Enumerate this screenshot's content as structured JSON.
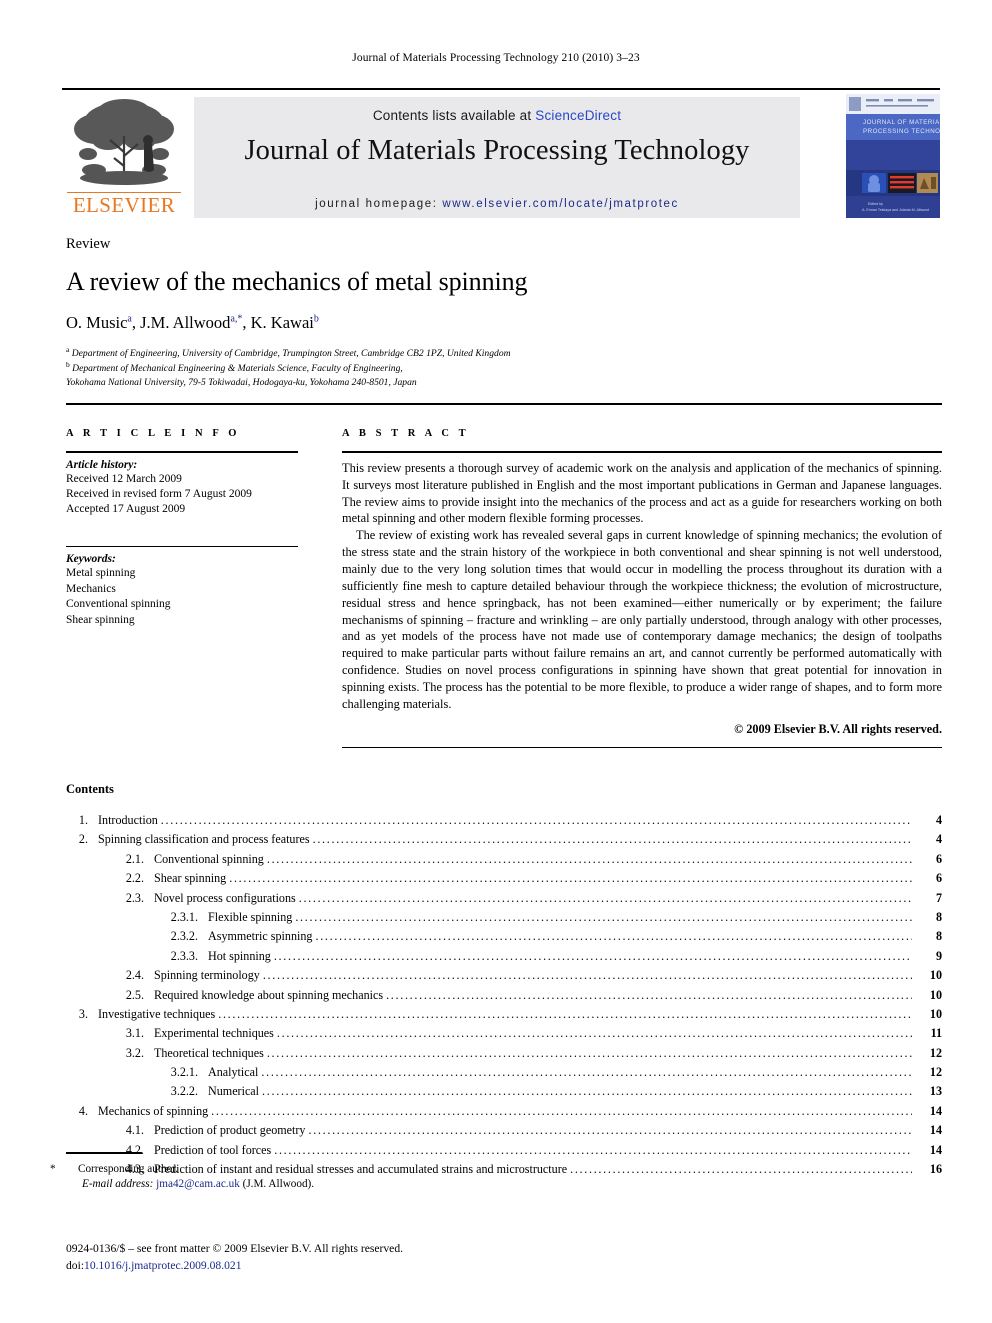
{
  "running_head": "Journal of Materials Processing Technology 210 (2010) 3–23",
  "masthead": {
    "contents_prefix": "Contents lists available at ",
    "sciencedirect": "ScienceDirect",
    "journal_title": "Journal of Materials Processing Technology",
    "homepage_prefix": "journal homepage:",
    "homepage_url": "www.elsevier.com/locate/jmatprotec",
    "publisher": "ELSEVIER",
    "cover": {
      "line1": "JOURNAL OF MATERIALS",
      "line2": "PROCESSING TECHNOLOGY",
      "edited_by": "Edited by",
      "editors": "A. Erman Tekkaya and Jolanta M. Allwood"
    },
    "link_color": "#2a46c8",
    "url_color": "#1b2a8a",
    "elsevier_orange": "#E87722",
    "banner_bg": "#e9e9eb"
  },
  "title_block": {
    "doctype": "Review",
    "title": "A review of the mechanics of metal spinning",
    "authors": [
      {
        "name": "O. Music",
        "sup": "a"
      },
      {
        "name": "J.M. Allwood",
        "sup": "a,*"
      },
      {
        "name": "K. Kawai",
        "sup": "b"
      }
    ],
    "affiliations": [
      {
        "marker": "a",
        "text": "Department of Engineering, University of Cambridge, Trumpington Street, Cambridge CB2 1PZ, United Kingdom"
      },
      {
        "marker": "b",
        "text": "Department of Mechanical Engineering & Materials Science, Faculty of Engineering,"
      },
      {
        "marker": "",
        "text": "Yokohama National University, 79-5 Tokiwadai, Hodogaya-ku, Yokohama 240-8501, Japan"
      }
    ]
  },
  "article_info": {
    "heading": "A R T I C L E    I N F O",
    "history_label": "Article history:",
    "history": [
      "Received 12 March 2009",
      "Received in revised form 7 August 2009",
      "Accepted 17 August 2009"
    ],
    "keywords_label": "Keywords:",
    "keywords": [
      "Metal spinning",
      "Mechanics",
      "Conventional spinning",
      "Shear spinning"
    ]
  },
  "abstract": {
    "heading": "A B S T R A C T",
    "paragraphs": [
      "This review presents a thorough survey of academic work on the analysis and application of the mechanics of spinning. It surveys most literature published in English and the most important publications in German and Japanese languages. The review aims to provide insight into the mechanics of the process and act as a guide for researchers working on both metal spinning and other modern flexible forming processes.",
      "The review of existing work has revealed several gaps in current knowledge of spinning mechanics; the evolution of the stress state and the strain history of the workpiece in both conventional and shear spinning is not well understood, mainly due to the very long solution times that would occur in modelling the process throughout its duration with a sufficiently fine mesh to capture detailed behaviour through the workpiece thickness; the evolution of microstructure, residual stress and hence springback, has not been examined—either numerically or by experiment; the failure mechanisms of spinning – fracture and wrinkling – are only partially understood, through analogy with other processes, and as yet models of the process have not made use of contemporary damage mechanics; the design of toolpaths required to make particular parts without failure remains an art, and cannot currently be performed automatically with confidence. Studies on novel process configurations in spinning have shown that great potential for innovation in spinning exists. The process has the potential to be more flexible, to produce a wider range of shapes, and to form more challenging materials."
    ],
    "copyright": "© 2009 Elsevier B.V. All rights reserved."
  },
  "contents": {
    "heading": "Contents",
    "items": [
      {
        "level": 1,
        "num": "1.",
        "label": "Introduction",
        "page": "4"
      },
      {
        "level": 1,
        "num": "2.",
        "label": "Spinning classification and process features",
        "page": "4"
      },
      {
        "level": 2,
        "num": "2.1.",
        "label": "Conventional spinning",
        "page": "6"
      },
      {
        "level": 2,
        "num": "2.2.",
        "label": "Shear spinning",
        "page": "6"
      },
      {
        "level": 2,
        "num": "2.3.",
        "label": "Novel process configurations",
        "page": "7"
      },
      {
        "level": 3,
        "num": "2.3.1.",
        "label": "Flexible spinning",
        "page": "8"
      },
      {
        "level": 3,
        "num": "2.3.2.",
        "label": "Asymmetric spinning",
        "page": "8"
      },
      {
        "level": 3,
        "num": "2.3.3.",
        "label": "Hot spinning",
        "page": "9"
      },
      {
        "level": 2,
        "num": "2.4.",
        "label": "Spinning terminology",
        "page": "10"
      },
      {
        "level": 2,
        "num": "2.5.",
        "label": "Required knowledge about spinning mechanics",
        "page": "10"
      },
      {
        "level": 1,
        "num": "3.",
        "label": "Investigative techniques",
        "page": "10"
      },
      {
        "level": 2,
        "num": "3.1.",
        "label": "Experimental techniques",
        "page": "11"
      },
      {
        "level": 2,
        "num": "3.2.",
        "label": "Theoretical techniques",
        "page": "12"
      },
      {
        "level": 3,
        "num": "3.2.1.",
        "label": "Analytical",
        "page": "12"
      },
      {
        "level": 3,
        "num": "3.2.2.",
        "label": "Numerical",
        "page": "13"
      },
      {
        "level": 1,
        "num": "4.",
        "label": "Mechanics of spinning",
        "page": "14"
      },
      {
        "level": 2,
        "num": "4.1.",
        "label": "Prediction of product geometry",
        "page": "14"
      },
      {
        "level": 2,
        "num": "4.2.",
        "label": "Prediction of tool forces",
        "page": "14"
      },
      {
        "level": 2,
        "num": "4.3.",
        "label": "Prediction of instant and residual stresses and accumulated strains and microstructure",
        "page": "16"
      }
    ]
  },
  "footnote": {
    "star": "*",
    "corresponding": "Corresponding author.",
    "email_label": "E-mail address:",
    "email": "jma42@cam.ac.uk",
    "email_owner": "(J.M. Allwood)."
  },
  "imprint": {
    "line1": "0924-0136/$ – see front matter © 2009 Elsevier B.V. All rights reserved.",
    "doi_label": "doi:",
    "doi": "10.1016/j.jmatprotec.2009.08.021"
  }
}
